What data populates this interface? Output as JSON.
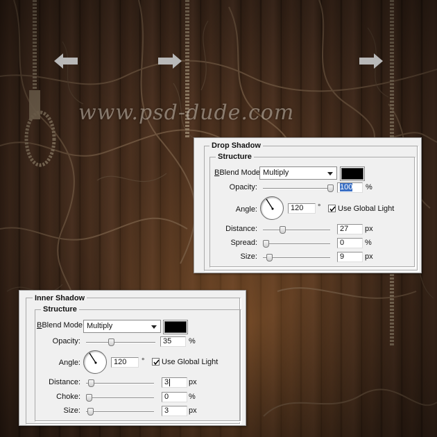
{
  "watermark": "www.psd-dude.com",
  "nav": {
    "left_icon": "arrow-left-icon",
    "right_icon": "arrow-right-icon"
  },
  "drop_shadow": {
    "title": "Drop Shadow",
    "section": "Structure",
    "blend_mode_label": "Blend Mode:",
    "blend_mode_value": "Multiply",
    "color": "#000000",
    "opacity_label": "Opacity:",
    "opacity_value": "100",
    "opacity_unit": "%",
    "opacity_fraction": 1.0,
    "angle_label": "Angle:",
    "angle_value": "120",
    "angle_unit": "°",
    "global_light_label": "Use Global Light",
    "global_light_checked": true,
    "distance_label": "Distance:",
    "distance_value": "27",
    "distance_unit": "px",
    "distance_fraction": 0.27,
    "spread_label": "Spread:",
    "spread_value": "0",
    "spread_unit": "%",
    "spread_fraction": 0.0,
    "size_label": "Size:",
    "size_value": "9",
    "size_unit": "px",
    "size_fraction": 0.06
  },
  "inner_shadow": {
    "title": "Inner Shadow",
    "section": "Structure",
    "blend_mode_label": "Blend Mode:",
    "blend_mode_value": "Multiply",
    "color": "#000000",
    "opacity_label": "Opacity:",
    "opacity_value": "35",
    "opacity_unit": "%",
    "opacity_fraction": 0.35,
    "angle_label": "Angle:",
    "angle_value": "120",
    "angle_unit": "°",
    "global_light_label": "Use Global Light",
    "global_light_checked": true,
    "distance_label": "Distance:",
    "distance_value": "3",
    "distance_unit": "px",
    "distance_fraction": 0.03,
    "choke_label": "Choke:",
    "choke_value": "0",
    "choke_unit": "%",
    "choke_fraction": 0.0,
    "size_label": "Size:",
    "size_value": "3",
    "size_unit": "px",
    "size_fraction": 0.02
  }
}
